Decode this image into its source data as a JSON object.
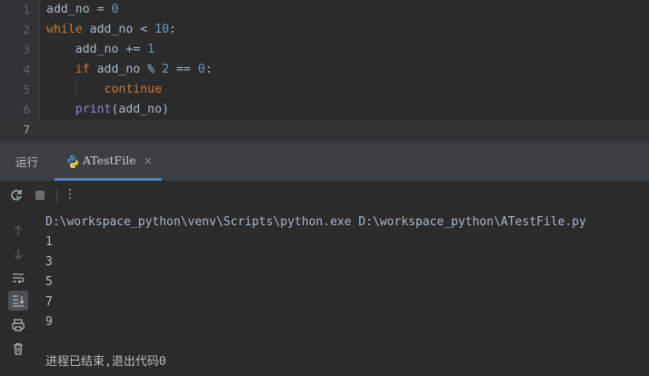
{
  "editor": {
    "line_numbers": [
      "1",
      "2",
      "3",
      "4",
      "5",
      "6",
      "7"
    ],
    "lines": [
      [
        {
          "t": "add_no",
          "c": "var"
        },
        {
          "t": " = ",
          "c": "var"
        },
        {
          "t": "0",
          "c": "num"
        }
      ],
      [
        {
          "t": "while",
          "c": "kw"
        },
        {
          "t": " add_no < ",
          "c": "var"
        },
        {
          "t": "10",
          "c": "num"
        },
        {
          "t": ":",
          "c": "var"
        }
      ],
      [
        {
          "t": "    add_no += ",
          "c": "var"
        },
        {
          "t": "1",
          "c": "num"
        }
      ],
      [
        {
          "t": "    ",
          "c": "var"
        },
        {
          "t": "if",
          "c": "kw"
        },
        {
          "t": " add_no % ",
          "c": "var"
        },
        {
          "t": "2",
          "c": "num"
        },
        {
          "t": " == ",
          "c": "var"
        },
        {
          "t": "0",
          "c": "num"
        },
        {
          "t": ":",
          "c": "var"
        }
      ],
      [
        {
          "t": "        ",
          "c": "var"
        },
        {
          "t": "continue",
          "c": "kw"
        }
      ],
      [
        {
          "t": "    ",
          "c": "var"
        },
        {
          "t": "print",
          "c": "fn"
        },
        {
          "t": "(add_no)",
          "c": "var"
        }
      ],
      []
    ],
    "current_line": 7
  },
  "run_panel": {
    "label": "运行",
    "tab_label": "ATestFile",
    "tab_close": "×",
    "tab_icon": "python-icon"
  },
  "toolbar": {
    "rerun_icon": "rerun-icon",
    "stop_icon": "stop-icon",
    "more_label": "⋮"
  },
  "console": {
    "command": "D:\\workspace_python\\venv\\Scripts\\python.exe D:\\workspace_python\\ATestFile.py",
    "outputs": [
      "1",
      "3",
      "5",
      "7",
      "9"
    ],
    "exit_message": "进程已结束,退出代码0"
  },
  "colors": {
    "keyword": "#cc7832",
    "number": "#6897bb",
    "builtin": "#8888c6",
    "tab_underline": "#4a88c7"
  }
}
